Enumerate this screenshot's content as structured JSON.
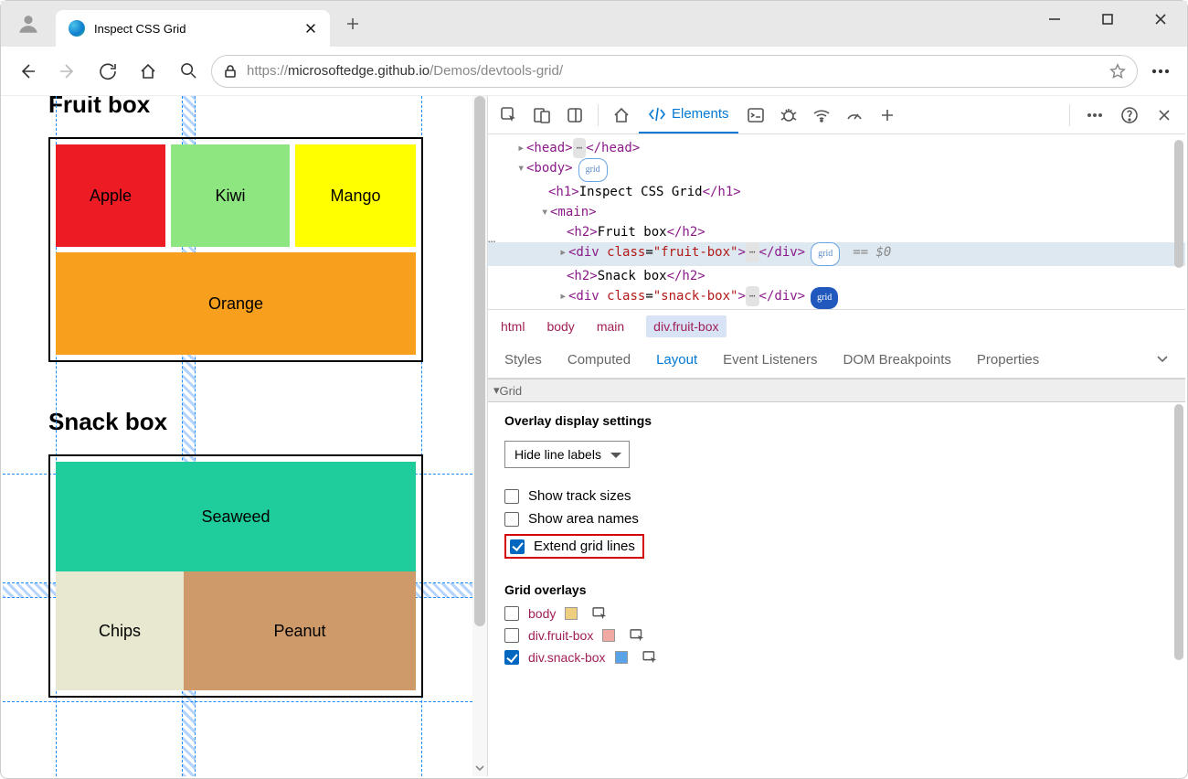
{
  "titlebar": {
    "tab_title": "Inspect CSS Grid"
  },
  "url": {
    "lock": "🔒",
    "scheme": "https://",
    "host": "microsoftedge.github.io",
    "path": "/Demos/devtools-grid/"
  },
  "page": {
    "h2_fruit": "Fruit box",
    "h2_snack": "Snack box",
    "fruit": {
      "apple": "Apple",
      "kiwi": "Kiwi",
      "mango": "Mango",
      "orange": "Orange"
    },
    "snack": {
      "seaweed": "Seaweed",
      "chips": "Chips",
      "peanut": "Peanut"
    }
  },
  "devtools": {
    "elements_label": "Elements",
    "dom": {
      "head_open": "<head>",
      "head_close": "</head>",
      "body_open": "<body>",
      "grid_badge": "grid",
      "h1_open": "<h1>",
      "h1_text": "Inspect CSS Grid",
      "h1_close": "</h1>",
      "main_open": "<main>",
      "h2f_open": "<h2>",
      "h2f_text": "Fruit box",
      "h2f_close": "</h2>",
      "div_open": "<div ",
      "class_kw": "class",
      "eq": "=",
      "fruit_val": "\"fruit-box\"",
      "gt": ">",
      "div_close": "</div>",
      "h2s_text": "Snack box",
      "snack_val": "\"snack-box\"",
      "sel_eq": "== $0"
    },
    "crumbs": {
      "a": "html",
      "b": "body",
      "c": "main",
      "d": "div.fruit-box"
    },
    "subtabs": {
      "styles": "Styles",
      "computed": "Computed",
      "layout": "Layout",
      "event": "Event Listeners",
      "dom": "DOM Breakpoints",
      "props": "Properties"
    },
    "grid_section": "Grid",
    "overlay_title": "Overlay display settings",
    "select_val": "Hide line labels",
    "chk_track": "Show track sizes",
    "chk_area": "Show area names",
    "chk_extend": "Extend grid lines",
    "overlays_title": "Grid overlays",
    "overlays": {
      "body": "body",
      "fruit": "div.fruit-box",
      "snack": "div.snack-box"
    }
  }
}
